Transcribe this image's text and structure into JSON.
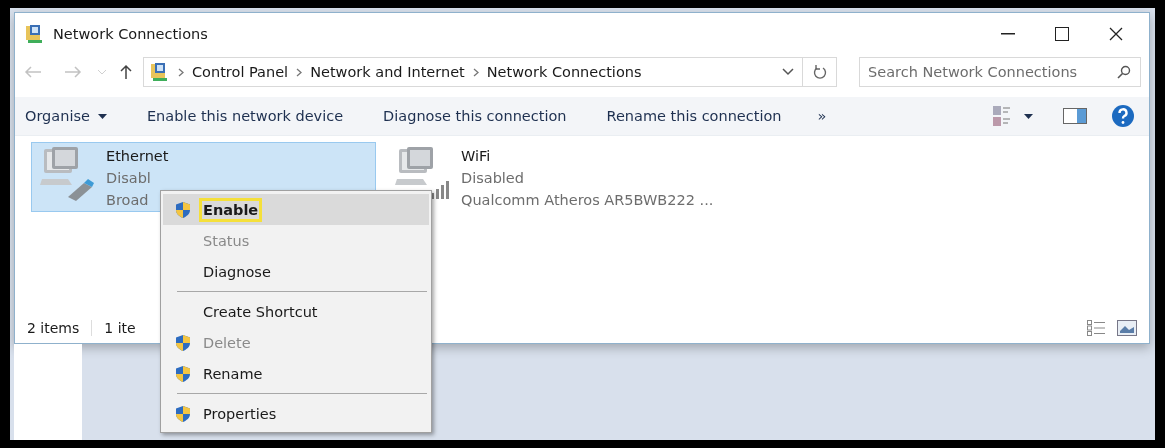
{
  "window": {
    "title": "Network Connections"
  },
  "address_bar": {
    "path": [
      "Control Panel",
      "Network and Internet",
      "Network Connections"
    ]
  },
  "search": {
    "placeholder": "Search Network Connections"
  },
  "command_bar": {
    "items": [
      {
        "label": "Organise",
        "kind": "dropdown"
      },
      {
        "label": "Enable this network device",
        "kind": "button"
      },
      {
        "label": "Diagnose this connection",
        "kind": "button"
      },
      {
        "label": "Rename this connection",
        "kind": "button"
      },
      {
        "label": "»",
        "kind": "more"
      }
    ]
  },
  "connections": [
    {
      "name": "Ethernet",
      "status": "Disabl",
      "device": "Broad",
      "kind": "wired",
      "selected": true
    },
    {
      "name": "WiFi",
      "status": "Disabled",
      "device": "Qualcomm Atheros AR5BWB222 ...",
      "kind": "wireless",
      "selected": false
    }
  ],
  "status_bar": {
    "count": "2 items",
    "selection": "1 ite"
  },
  "context_menu": {
    "items": [
      {
        "kind": "item",
        "label": "Enable",
        "shield": true,
        "bold": true,
        "disabled": false,
        "selected": true,
        "outlined": true
      },
      {
        "kind": "item",
        "label": "Status",
        "shield": false,
        "bold": false,
        "disabled": true,
        "selected": false,
        "outlined": false
      },
      {
        "kind": "item",
        "label": "Diagnose",
        "shield": false,
        "bold": false,
        "disabled": false,
        "selected": false,
        "outlined": false
      },
      {
        "kind": "separator"
      },
      {
        "kind": "item",
        "label": "Create Shortcut",
        "shield": false,
        "bold": false,
        "disabled": false,
        "selected": false,
        "outlined": false
      },
      {
        "kind": "item",
        "label": "Delete",
        "shield": true,
        "bold": false,
        "disabled": true,
        "selected": false,
        "outlined": false
      },
      {
        "kind": "item",
        "label": "Rename",
        "shield": true,
        "bold": false,
        "disabled": false,
        "selected": false,
        "outlined": false
      },
      {
        "kind": "separator"
      },
      {
        "kind": "item",
        "label": "Properties",
        "shield": true,
        "bold": false,
        "disabled": false,
        "selected": false,
        "outlined": false
      }
    ]
  }
}
